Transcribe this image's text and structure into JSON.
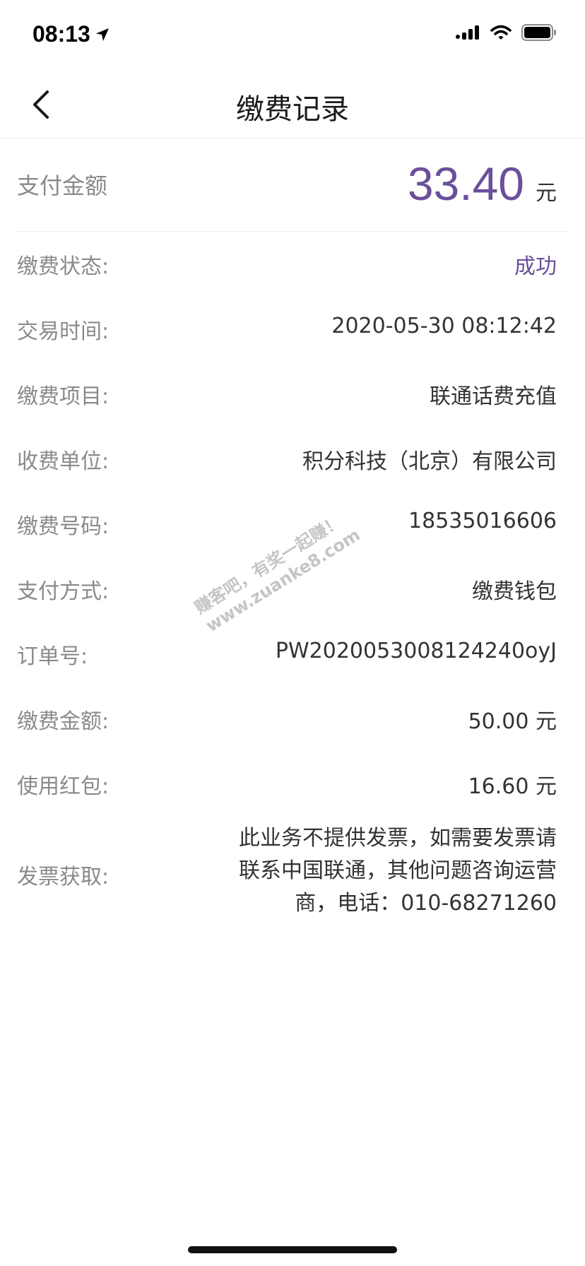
{
  "status_bar": {
    "time": "08:13"
  },
  "nav": {
    "title": "缴费记录"
  },
  "amount": {
    "label": "支付金额",
    "value": "33.40",
    "unit": "元"
  },
  "details": {
    "status": {
      "label": "缴费状态:",
      "value": "成功"
    },
    "time": {
      "label": "交易时间:",
      "value": "2020-05-30 08:12:42"
    },
    "item": {
      "label": "缴费项目:",
      "value": "联通话费充值"
    },
    "payee": {
      "label": "收费单位:",
      "value": "积分科技（北京）有限公司"
    },
    "number": {
      "label": "缴费号码:",
      "value": "18535016606"
    },
    "method": {
      "label": "支付方式:",
      "value": "缴费钱包"
    },
    "order": {
      "label": "订单号:",
      "value": "PW2020053008124240oyJ"
    },
    "fee": {
      "label": "缴费金额:",
      "value": "50.00 元"
    },
    "redpacket": {
      "label": "使用红包:",
      "value": "16.60 元"
    },
    "invoice": {
      "label": "发票获取:",
      "line1": "此业务不提供发票，如需要发票请",
      "line2": "联系中国联通，其他问题咨询运营",
      "line3": "商，电话：010-68271260"
    }
  },
  "watermark": {
    "line1": "赚客吧，有奖一起赚！",
    "line2": "www.zuanke8.com"
  },
  "colors": {
    "accent": "#6a4f9a",
    "label": "#8a8a8a",
    "text": "#333333",
    "divider": "#ececec"
  }
}
